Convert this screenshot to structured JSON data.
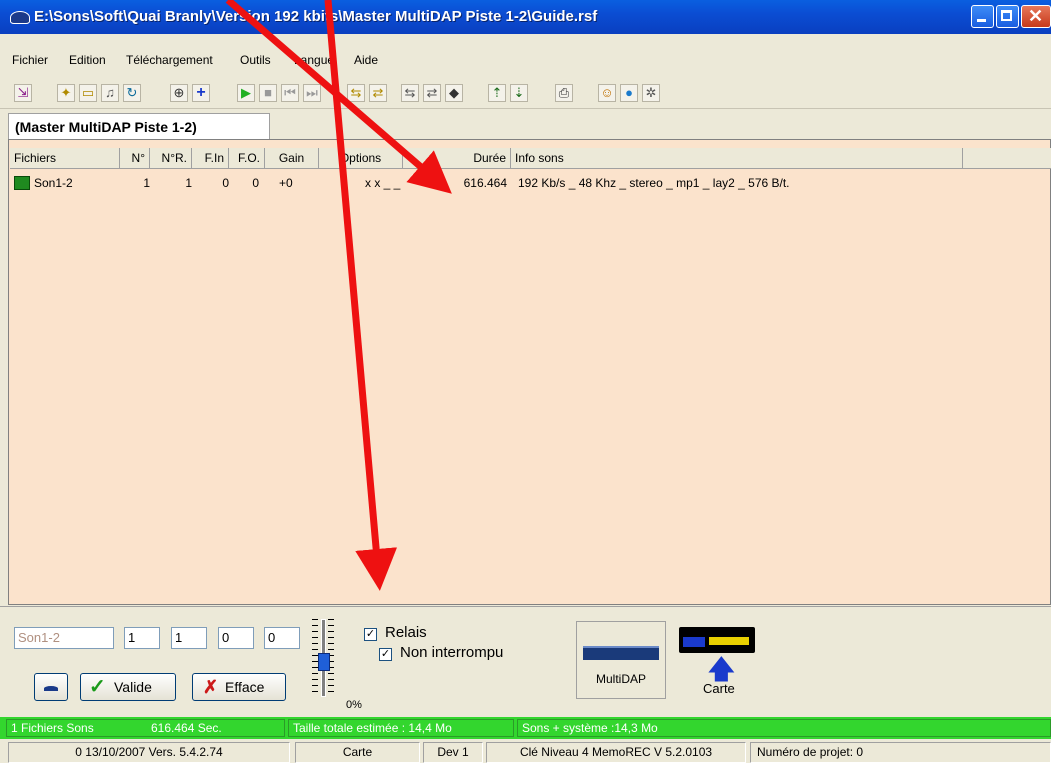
{
  "window": {
    "title": "E:\\Sons\\Soft\\Quai Branly\\Version 192 kbits\\Master MultiDAP Piste 1-2\\Guide.rsf"
  },
  "menu": [
    "Fichier",
    "Edition",
    "Téléchargement",
    "Outils",
    "Langue",
    "Aide"
  ],
  "tab": {
    "label": "(Master MultiDAP Piste 1-2)"
  },
  "table": {
    "columns": [
      "Fichiers",
      "N°",
      "N°R.",
      "F.In",
      "F.O.",
      "Gain",
      "Options",
      "Durée",
      "Info sons"
    ],
    "rows": [
      {
        "file": "Son1-2",
        "n": "1",
        "nr": "1",
        "fin": "0",
        "fo": "0",
        "gain": "+0",
        "options": "x x _ _",
        "duree": "616.464",
        "info": "192 Kb/s _ 48 Khz _ stereo _ mp1 _ lay2 _ 576 B/t."
      }
    ]
  },
  "editor": {
    "name_placeholder": "Son1-2",
    "n": "1",
    "nr": "1",
    "fin": "0",
    "fo": "0",
    "slider_percent": "0%",
    "relais_label": "Relais",
    "non_interrompu_label": "Non interrompu",
    "valide_label": "Valide",
    "efface_label": "Efface",
    "multidap_label": "MultiDAP",
    "carte_label": "Carte"
  },
  "status_green": {
    "files": "1 Fichiers Sons",
    "seconds": "616.464 Sec.",
    "taille": "Taille totale estimée :  14,4 Mo",
    "systeme": "Sons + système :14,3 Mo"
  },
  "status_bottom": {
    "version": "0  13/10/2007  Vers. 5.4.2.74",
    "carte": "Carte",
    "dev": "Dev 1",
    "cle": "Clé Niveau 4  MemoREC V 5.2.0103",
    "projet": "Numéro de projet: 0"
  },
  "colors": {
    "accent_green": "#33d62e",
    "list_bg": "#fbe3cc",
    "arrow": "#ee1111"
  }
}
